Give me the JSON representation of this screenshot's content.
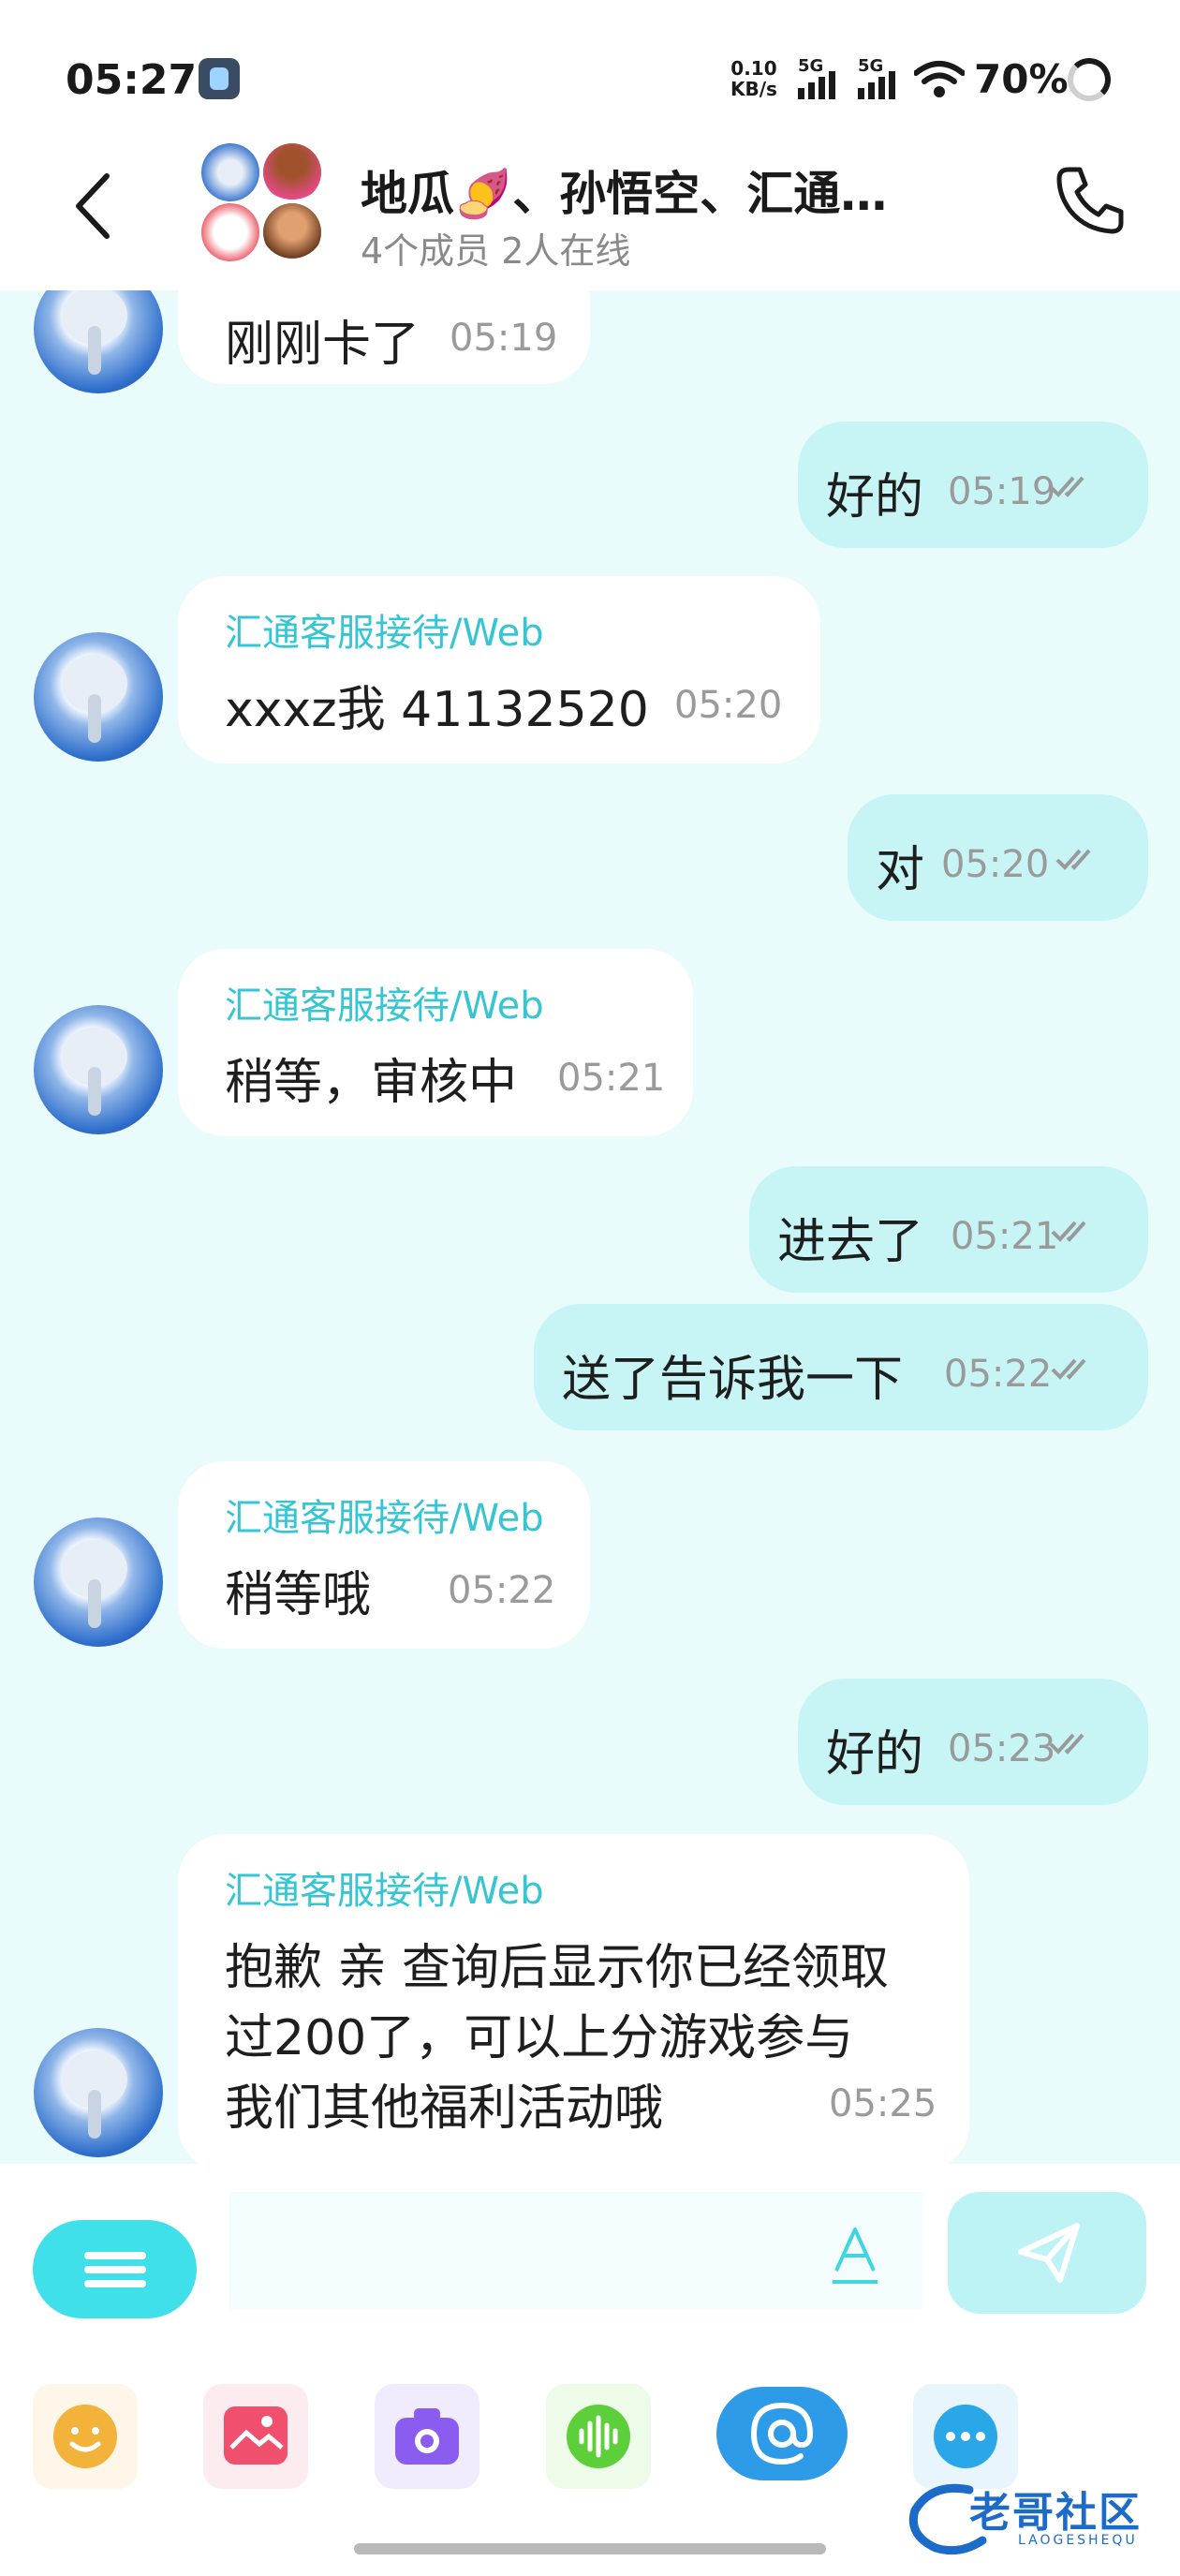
{
  "status_bar": {
    "time": "05:27",
    "net_speed_value": "0.10",
    "net_speed_unit": "KB/s",
    "sim1": "5G",
    "sim2": "5G",
    "battery": "70%"
  },
  "header": {
    "title": "地瓜🍠、孙悟空、汇通…",
    "subtitle": "4个成员  2人在线"
  },
  "messages": [
    {
      "side": "in",
      "text": "刚刚卡了",
      "time": "05:19"
    },
    {
      "side": "out",
      "text": "好的",
      "time": "05:19",
      "read": true
    },
    {
      "side": "in",
      "sender": "汇通客服接待/Web",
      "text": "xxxz我   41132520",
      "time": "05:20"
    },
    {
      "side": "out",
      "text": "对",
      "time": "05:20",
      "read": true
    },
    {
      "side": "in",
      "sender": "汇通客服接待/Web",
      "text": "稍等，审核中",
      "time": "05:21"
    },
    {
      "side": "out",
      "text": "进去了",
      "time": "05:21",
      "read": true
    },
    {
      "side": "out",
      "text": "送了告诉我一下",
      "time": "05:22",
      "read": true
    },
    {
      "side": "in",
      "sender": "汇通客服接待/Web",
      "text": "稍等哦",
      "time": "05:22"
    },
    {
      "side": "out",
      "text": "好的",
      "time": "05:23",
      "read": true
    },
    {
      "side": "in",
      "sender": "汇通客服接待/Web",
      "lines": [
        "抱歉 亲 查询后显示你已经领取",
        "过200了，可以上分游戏参与",
        "我们其他福利活动哦"
      ],
      "time": "05:25"
    }
  ],
  "input": {
    "value": "",
    "placeholder": ""
  },
  "toolbar": [
    {
      "icon": "emoji-icon",
      "color": "#f3b23a"
    },
    {
      "icon": "image-icon",
      "color": "#f0506e"
    },
    {
      "icon": "camera-icon",
      "color": "#8a5cf0"
    },
    {
      "icon": "voice-icon",
      "color": "#5ccf3a"
    },
    {
      "icon": "at-mention-icon",
      "color": "#2e9be8"
    },
    {
      "icon": "more-icon",
      "color": "#2aa7e6"
    }
  ],
  "watermark": {
    "text": "老哥社区",
    "sub": "LAOGESHEQU"
  },
  "colors": {
    "accent": "#3fe0ea",
    "sender": "#36c6d3",
    "outgoing_bubble": "#c7f5f6",
    "chat_bg": "#e9fbfb"
  }
}
